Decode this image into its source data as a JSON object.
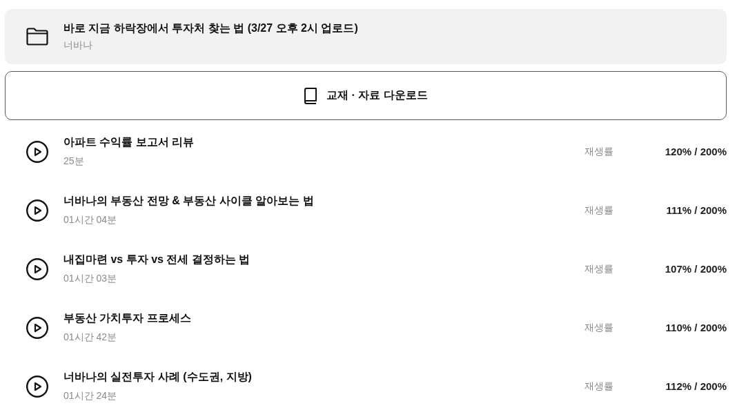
{
  "folder": {
    "title": "바로 지금 하락장에서 투자처 찾는 법 (3/27 오후 2시 업로드)",
    "author": "너바나"
  },
  "download_button": {
    "label": "교재 · 자료 다운로드"
  },
  "lessons": [
    {
      "title": "아파트 수익률 보고서 리뷰",
      "duration": "25분",
      "progress_label": "재생률",
      "progress": "120% / 200%"
    },
    {
      "title": "너바나의 부동산 전망 & 부동산 사이클 알아보는 법",
      "duration": "01시간 04분",
      "progress_label": "재생률",
      "progress": "111% / 200%"
    },
    {
      "title": "내집마련 vs 투자 vs 전세 결정하는 법",
      "duration": "01시간 03분",
      "progress_label": "재생률",
      "progress": "107% / 200%"
    },
    {
      "title": "부동산 가치투자 프로세스",
      "duration": "01시간 42분",
      "progress_label": "재생률",
      "progress": "110% / 200%"
    },
    {
      "title": "너바나의 실전투자 사례 (수도권, 지방)",
      "duration": "01시간 24분",
      "progress_label": "재생률",
      "progress": "112% / 200%"
    }
  ]
}
